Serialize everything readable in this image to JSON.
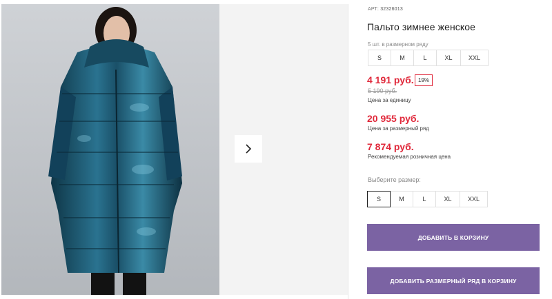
{
  "gallery": {
    "next_icon": "chevron-right-icon"
  },
  "product": {
    "article_label": "АРТ:",
    "article_code": "32326013",
    "title": "Пальто зимнее женское",
    "pack_note": "5 шт. в размерном ряду",
    "pack_sizes": [
      "S",
      "M",
      "L",
      "XL",
      "XXL"
    ],
    "price_unit": "4 191 руб.",
    "discount": "19%",
    "old_price": "5 190 руб.",
    "unit_caption": "Цена за единицу",
    "price_pack": "20 955 руб.",
    "pack_caption": "Цена за размерный ряд",
    "price_retail": "7 874 руб.",
    "retail_caption": "Рекомендуемая розничная цена",
    "choose_label": "Выберите размер:",
    "select_sizes": [
      "S",
      "M",
      "L",
      "XL",
      "XXL"
    ],
    "selected_size": "S"
  },
  "actions": {
    "add_to_cart": "ДОБАВИТЬ В КОРЗИНУ",
    "add_pack_to_cart": "ДОБАВИТЬ РАЗМЕРНЫЙ РЯД В КОРЗИНУ"
  },
  "colors": {
    "price": "#e0283a",
    "button": "#7b63a3",
    "coat": "#1f5a73"
  }
}
